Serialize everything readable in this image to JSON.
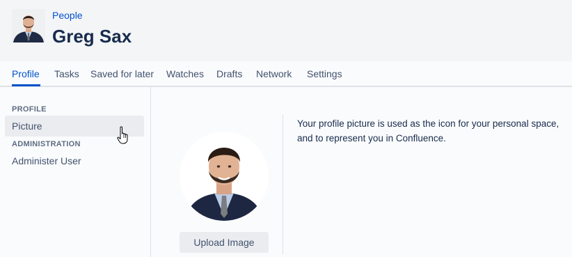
{
  "header": {
    "breadcrumb": "People",
    "title": "Greg Sax"
  },
  "tabs": [
    "Profile",
    "Tasks",
    "Saved for later",
    "Watches",
    "Drafts",
    "Network",
    "Settings"
  ],
  "active_tab": "Profile",
  "sidebar": {
    "sections": [
      {
        "label": "PROFILE",
        "items": [
          {
            "label": "Picture",
            "selected": true
          }
        ]
      },
      {
        "label": "ADMINISTRATION",
        "items": [
          {
            "label": "Administer User",
            "selected": false
          }
        ]
      }
    ]
  },
  "main": {
    "upload_button": "Upload Image",
    "description_line1": "Your profile picture is used as the icon for your personal space,",
    "description_line2": "and to represent you in Confluence."
  },
  "colors": {
    "accent": "#0052cc",
    "text": "#172b4d",
    "header_bg": "#f4f5f7",
    "content_bg": "#fafbfc"
  }
}
